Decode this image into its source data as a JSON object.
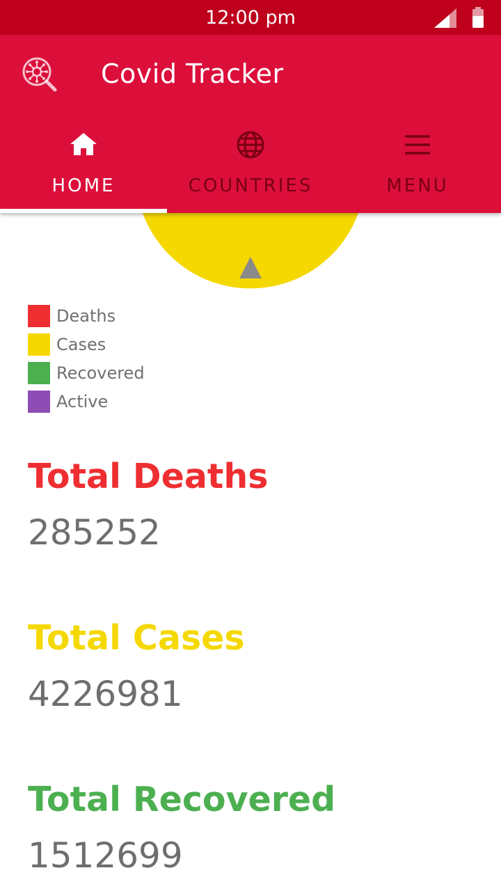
{
  "status_bar": {
    "time": "12:00 pm",
    "icons": [
      "signal-icon",
      "battery-icon"
    ]
  },
  "app_bar": {
    "title": "Covid Tracker",
    "logo_icon": "virus-search-icon"
  },
  "tabs": [
    {
      "label": "HOME",
      "icon": "home-icon",
      "selected": true
    },
    {
      "label": "COUNTRIES",
      "icon": "globe-icon",
      "selected": false
    },
    {
      "label": "MENU",
      "icon": "menu-icon",
      "selected": false
    }
  ],
  "colors": {
    "status_bar": "#bf001c",
    "app_bar": "#dc0f3b",
    "deaths": "#ee2e31",
    "cases": "#f5d800",
    "recovered": "#4caf50",
    "active": "#8e4db4",
    "value_text": "#6e6e6e"
  },
  "legend": [
    {
      "label": "Deaths",
      "color": "#ee2e31"
    },
    {
      "label": "Cases",
      "color": "#f5d800"
    },
    {
      "label": "Recovered",
      "color": "#4caf50"
    },
    {
      "label": "Active",
      "color": "#8e4db4"
    }
  ],
  "stats": {
    "deaths": {
      "title": "Total Deaths",
      "value": "285252"
    },
    "cases": {
      "title": "Total Cases",
      "value": "4226981"
    },
    "recovered": {
      "title": "Total Recovered",
      "value": "1512699"
    }
  }
}
